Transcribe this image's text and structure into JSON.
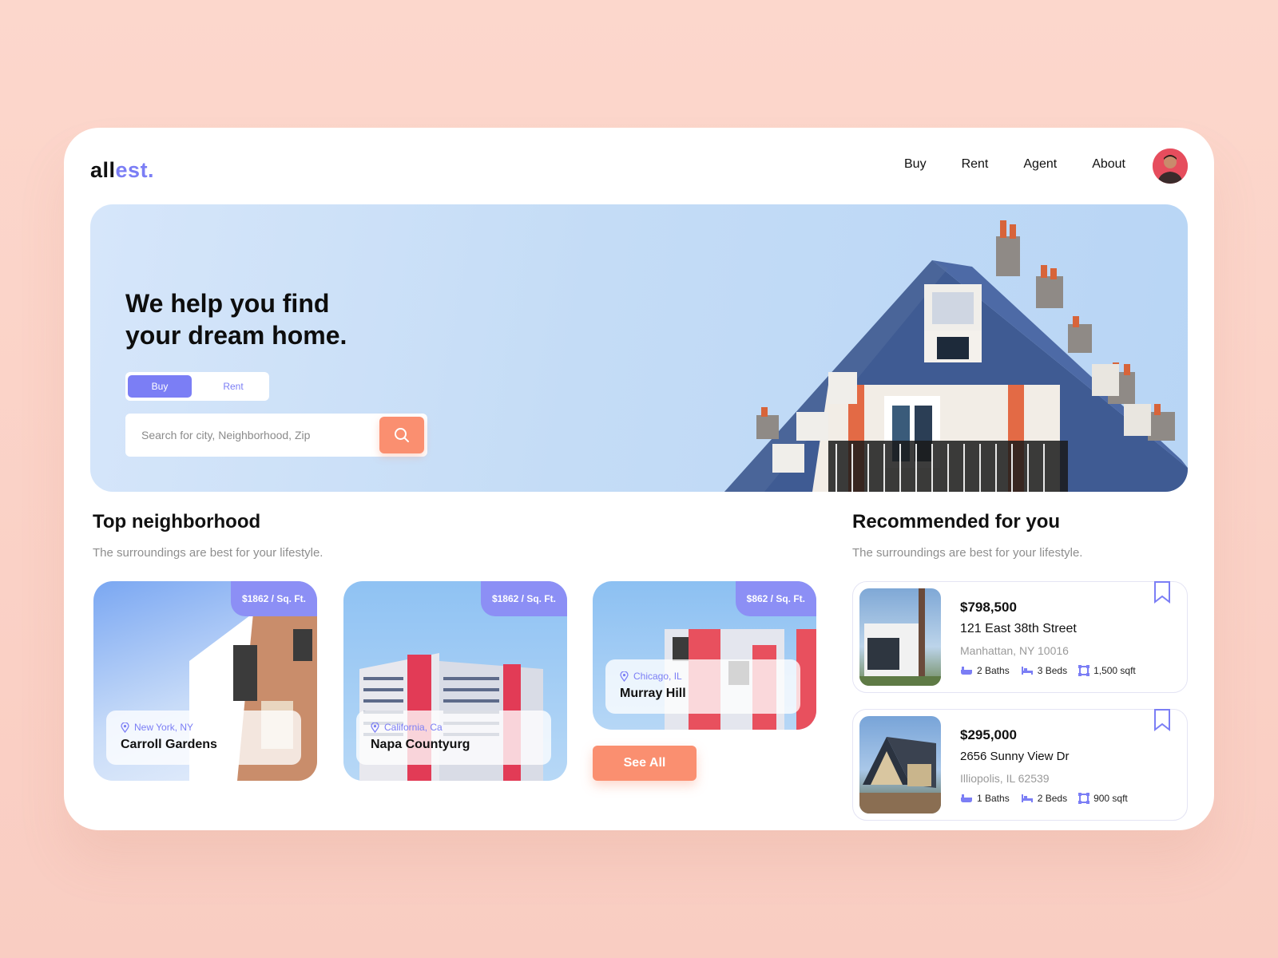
{
  "brand": {
    "logo_part1": "all",
    "logo_part2": "est."
  },
  "nav": {
    "items": [
      "Buy",
      "Rent",
      "Agent",
      "About"
    ]
  },
  "hero": {
    "title_line1": "We help you find",
    "title_line2": "your dream home.",
    "toggle": {
      "active": "Buy",
      "inactive": "Rent"
    },
    "search_placeholder": "Search for city, Neighborhood, Zip"
  },
  "neighborhood": {
    "title": "Top neighborhood",
    "subtitle": "The surroundings are best for your lifestyle.",
    "cards": [
      {
        "price": "$1862 / Sq. Ft.",
        "location": "New York, NY",
        "name": "Carroll Gardens"
      },
      {
        "price": "$1862 / Sq. Ft.",
        "location": "California, Ca",
        "name": "Napa Countyurg"
      },
      {
        "price": "$862 / Sq. Ft.",
        "location": "Chicago, IL",
        "name": "Murray Hill"
      }
    ],
    "see_all": "See All"
  },
  "recommended": {
    "title": "Recommended for you",
    "subtitle": "The surroundings are best for your lifestyle.",
    "items": [
      {
        "price": "$798,500",
        "address": "121 East 38th Street",
        "city": "Manhattan, NY 10016",
        "baths": "2 Baths",
        "beds": "3 Beds",
        "area": "1,500 sqft"
      },
      {
        "price": "$295,000",
        "address": "2656 Sunny View Dr",
        "city": "Illiopolis, IL 62539",
        "baths": "1 Baths",
        "beds": "2 Beds",
        "area": "900 sqft"
      }
    ]
  },
  "colors": {
    "accent": "#7b7ef5",
    "cta": "#fa8f70",
    "background": "#fcd7cc"
  }
}
